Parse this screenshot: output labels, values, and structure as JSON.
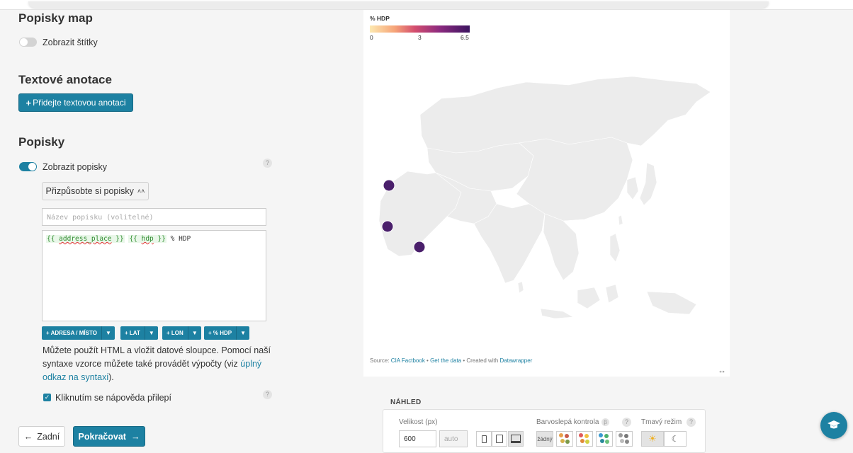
{
  "sections": {
    "map_labels": {
      "title": "Popisky map",
      "toggle_label": "Zobrazit štítky"
    },
    "text_annotations": {
      "title": "Textové anotace",
      "add_button": "Přidejte textovou anotaci"
    },
    "tooltips": {
      "title": "Popisky",
      "toggle_label": "Zobrazit popisky",
      "customize_button": "Přizpůsobte si popisky",
      "title_placeholder": "Název popisku (volitelné)",
      "template": {
        "token1_open": "{{ ",
        "token1_name": "address_place",
        "token1_close": " }}",
        "token2_open": "{{ ",
        "token2_name": "hdp",
        "token2_close": " }}",
        "suffix": " % HDP"
      },
      "column_buttons": [
        "+ ADRESA / MÍSTO",
        "+ LAT",
        "+ LON",
        "+ % HDP"
      ],
      "help_text_1": "Můžete použít HTML a vložit datové sloupce. Pomocí naší syntaxe vzorce můžete také provádět výpočty (viz ",
      "help_link": "úplný odkaz na syntaxi",
      "help_text_2": ").",
      "sticky_label": "Kliknutím se nápověda přilepí"
    }
  },
  "nav": {
    "back_label": "Zadní",
    "continue_label": "Pokračovat"
  },
  "map": {
    "legend_title": "% HDP",
    "legend_ticks": [
      "0",
      "3",
      "6.5"
    ],
    "point_color": "#4a1f6b",
    "source_prefix": "Source: ",
    "source_link": "CIA Factbook",
    "sep": " • ",
    "get_data": "Get the data",
    "created_with": "Created with ",
    "datawrapper": "Datawrapper"
  },
  "preview": {
    "title": "NÁHLED",
    "size_label": "Velikost (px)",
    "size_value": "600",
    "size_auto": "auto",
    "colorblind_label": "Barvoslepá kontrola",
    "colorblind_none": "žádný",
    "dark_label": "Tmavý režim"
  },
  "colors": {
    "accent": "#1d81a2"
  }
}
